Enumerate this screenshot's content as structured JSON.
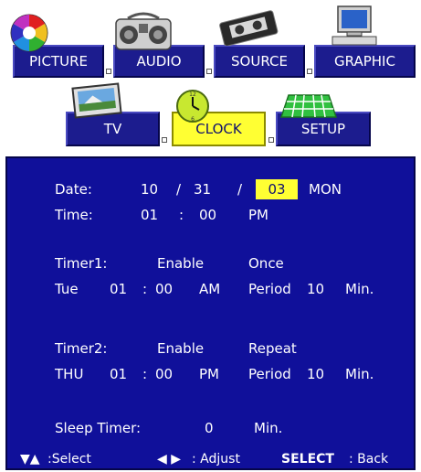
{
  "menu": {
    "top_tabs": [
      {
        "label": "PICTURE",
        "icon": "color-wheel-icon"
      },
      {
        "label": "AUDIO",
        "icon": "boombox-icon"
      },
      {
        "label": "SOURCE",
        "icon": "cassette-icon"
      },
      {
        "label": "GRAPHIC",
        "icon": "monitor-icon"
      }
    ],
    "sub_tabs": [
      {
        "label": "TV",
        "icon": "tv-picture-icon"
      },
      {
        "label": "CLOCK",
        "icon": "clock-icon",
        "selected": true
      },
      {
        "label": "SETUP",
        "icon": "grid-icon"
      }
    ]
  },
  "clock": {
    "date_label": "Date:",
    "month": "10",
    "sep1": "/",
    "day": "31",
    "sep2": "/",
    "year": "03",
    "weekday": "MON",
    "time_label": "Time:",
    "hour": "01",
    "colon": ":",
    "minute": "00",
    "ampm": "PM"
  },
  "timer1": {
    "label": "Timer1:",
    "state": "Enable",
    "mode": "Once",
    "day": "Tue",
    "hour": "01",
    "colon": ":",
    "minute": "00",
    "ampm": "AM",
    "period_label": "Period",
    "period_value": "10",
    "period_unit": "Min."
  },
  "timer2": {
    "label": "Timer2:",
    "state": "Enable",
    "mode": "Repeat",
    "day": "THU",
    "hour": "01",
    "colon": ":",
    "minute": "00",
    "ampm": "PM",
    "period_label": "Period",
    "period_value": "10",
    "period_unit": "Min."
  },
  "sleep": {
    "label": "Sleep Timer:",
    "value": "0",
    "unit": "Min."
  },
  "footer": {
    "select_arrows": "▼▲",
    "select_label": ":Select",
    "adjust_arrows": "◀ ▶",
    "adjust_label": ": Adjust",
    "select_key": "SELECT",
    "back_label": ": Back"
  },
  "colors": {
    "panel_bg": "#10109a",
    "tab_bg": "#1c1c8e",
    "highlight": "#ffff33",
    "text": "#ffffff"
  }
}
